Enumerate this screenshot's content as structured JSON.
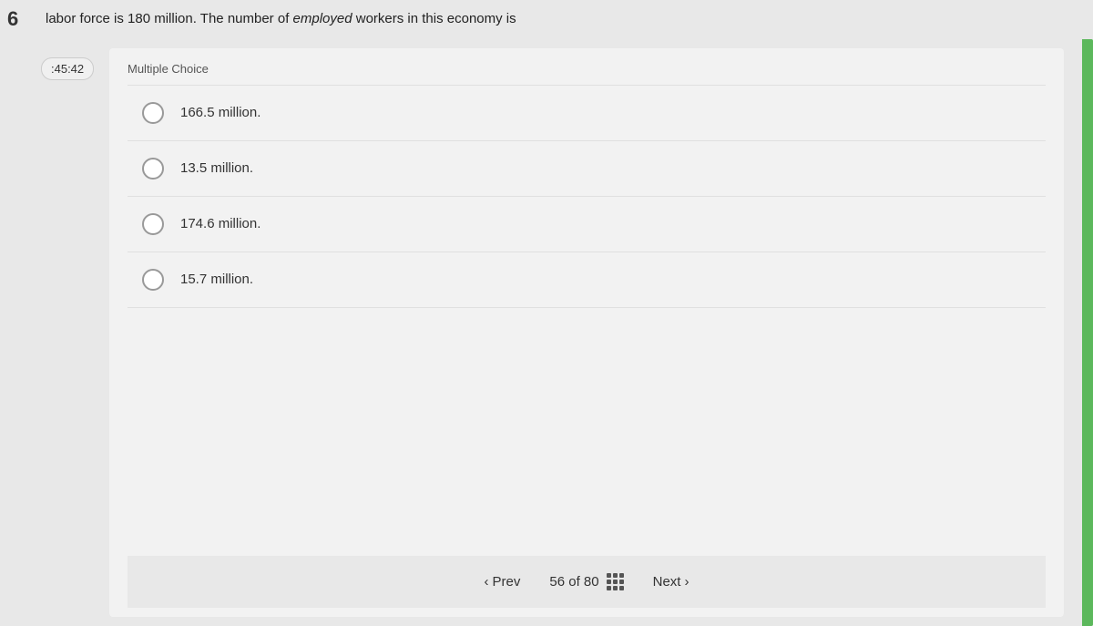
{
  "question": {
    "number": "6",
    "text_before": "labor force is 180 million. The number of ",
    "text_italic": "employed",
    "text_after": " workers in this economy is",
    "type_label": "Multiple Choice"
  },
  "timer": {
    "display": ":45:42"
  },
  "choices": [
    {
      "id": "a",
      "text": "166.5 million."
    },
    {
      "id": "b",
      "text": "13.5 million."
    },
    {
      "id": "c",
      "text": "174.6 million."
    },
    {
      "id": "d",
      "text": "15.7 million."
    }
  ],
  "navigation": {
    "prev_label": "Prev",
    "next_label": "Next",
    "current_page": "56",
    "total_pages": "80",
    "page_display": "56 of 80"
  }
}
